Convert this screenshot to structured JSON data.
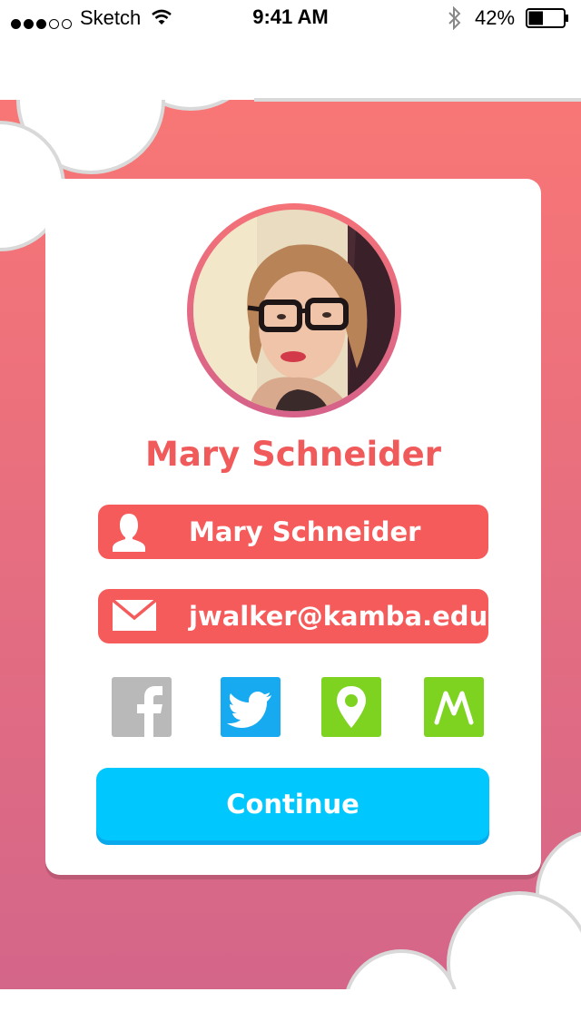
{
  "status_bar": {
    "signal_bars_filled": 3,
    "signal_bars_total": 5,
    "carrier": "Sketch",
    "time": "9:41 AM",
    "battery_percent": "42%",
    "battery_level": 0.42
  },
  "colors": {
    "gradient_top": "#f87675",
    "gradient_bottom": "#d4668a",
    "accent_red": "#f65b5b",
    "continue_blue": "#00c7fd",
    "facebook_gray": "#b9b9b9",
    "twitter_blue": "#18aaf1",
    "social_green": "#7ed321"
  },
  "profile": {
    "display_name": "Mary Schneider",
    "name_field": "Mary Schneider",
    "email_field": "jwalker@kamba.edu"
  },
  "icons": {
    "name_field": "user-icon",
    "email_field": "mail-icon"
  },
  "social": [
    {
      "name": "facebook",
      "icon": "facebook-icon"
    },
    {
      "name": "twitter",
      "icon": "twitter-icon"
    },
    {
      "name": "location",
      "icon": "location-pin-icon"
    },
    {
      "name": "m",
      "icon": "m-logo-icon"
    }
  ],
  "actions": {
    "continue_label": "Continue"
  }
}
